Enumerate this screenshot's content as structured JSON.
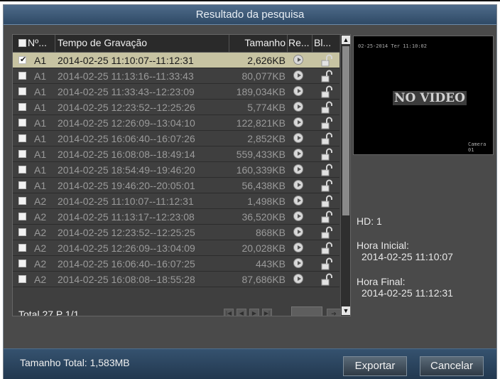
{
  "window": {
    "title": "Resultado da pesquisa"
  },
  "table": {
    "headers": {
      "no": "Nº...",
      "time": "Tempo de Gravação",
      "size": "Tamanho",
      "play": "Re...",
      "lock": "Bl..."
    },
    "rows": [
      {
        "ch": "A1",
        "time": "2014-02-25 11:10:07--11:12:31",
        "size": "2,626KB",
        "checked": true
      },
      {
        "ch": "A1",
        "time": "2014-02-25 11:13:16--11:33:43",
        "size": "80,077KB",
        "checked": false
      },
      {
        "ch": "A1",
        "time": "2014-02-25 11:33:43--12:23:09",
        "size": "189,034KB",
        "checked": false
      },
      {
        "ch": "A1",
        "time": "2014-02-25 12:23:52--12:25:26",
        "size": "5,774KB",
        "checked": false
      },
      {
        "ch": "A1",
        "time": "2014-02-25 12:26:09--13:04:10",
        "size": "122,821KB",
        "checked": false
      },
      {
        "ch": "A1",
        "time": "2014-02-25 16:06:40--16:07:26",
        "size": "2,852KB",
        "checked": false
      },
      {
        "ch": "A1",
        "time": "2014-02-25 16:08:08--18:49:14",
        "size": "559,433KB",
        "checked": false
      },
      {
        "ch": "A1",
        "time": "2014-02-25 18:54:49--19:46:20",
        "size": "160,339KB",
        "checked": false
      },
      {
        "ch": "A1",
        "time": "2014-02-25 19:46:20--20:05:01",
        "size": "56,438KB",
        "checked": false
      },
      {
        "ch": "A2",
        "time": "2014-02-25 11:10:07--11:12:31",
        "size": "1,498KB",
        "checked": false
      },
      {
        "ch": "A2",
        "time": "2014-02-25 11:13:17--12:23:08",
        "size": "36,520KB",
        "checked": false
      },
      {
        "ch": "A2",
        "time": "2014-02-25 12:23:52--12:25:25",
        "size": "868KB",
        "checked": false
      },
      {
        "ch": "A2",
        "time": "2014-02-25 12:26:09--13:04:09",
        "size": "20,028KB",
        "checked": false
      },
      {
        "ch": "A2",
        "time": "2014-02-25 16:06:40--16:07:25",
        "size": "443KB",
        "checked": false
      },
      {
        "ch": "A2",
        "time": "2014-02-25 16:08:08--18:55:28",
        "size": "87,686KB",
        "checked": false
      }
    ],
    "total": "Total 27 P 1/1"
  },
  "preview": {
    "timestamp": "02-25-2014 Ter 11:10:02",
    "no_video": "NO VIDEO",
    "camera": "Camera 01"
  },
  "info": {
    "hd": "HD: 1",
    "start_label": "Hora Inicial:",
    "start_value": "2014-02-25 11:10:07",
    "end_label": "Hora Final:",
    "end_value": "2014-02-25 11:12:31"
  },
  "bottom": {
    "total_size": "Tamanho Total: 1,583MB",
    "export_label": "Exportar",
    "cancel_label": "Cancelar"
  },
  "icons": {
    "play": "play-circle-icon",
    "lock": "unlocked-padlock-icon",
    "nav": [
      "first-page-icon",
      "prev-page-icon",
      "next-page-icon",
      "last-page-icon"
    ]
  },
  "colors": {
    "selected_row": "#c7c3a2",
    "title_bar": "#3e5b78",
    "panel": "#4a4a4a"
  }
}
